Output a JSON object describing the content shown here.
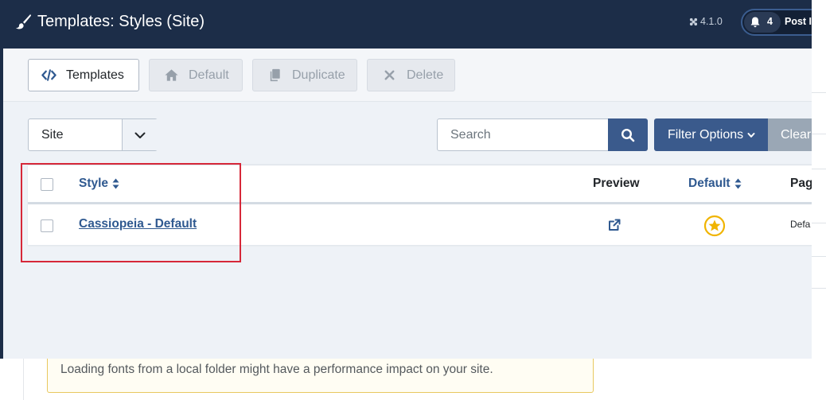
{
  "header": {
    "title": "Templates: Styles (Site)",
    "version": "4.1.0",
    "notifications_count": "4",
    "post_label": "Post In"
  },
  "toolbar": {
    "templates_label": "Templates",
    "default_label": "Default",
    "duplicate_label": "Duplicate",
    "delete_label": "Delete"
  },
  "filters": {
    "client_select_value": "Site",
    "search_placeholder": "Search",
    "filter_options_label": "Filter Options",
    "clear_label": "Clear"
  },
  "table": {
    "columns": {
      "style": "Style",
      "preview": "Preview",
      "default": "Default",
      "pages": "Pag"
    },
    "rows": [
      {
        "style": "Cassiopeia - Default",
        "pages": "Defa"
      }
    ]
  },
  "alert": {
    "text": "Loading fonts from a local folder might have a performance impact on your site."
  },
  "colors": {
    "header_bg": "#1c2d48",
    "primary": "#3a5a8c",
    "link": "#2f5990",
    "highlight": "#d62839",
    "star": "#f0b400"
  }
}
